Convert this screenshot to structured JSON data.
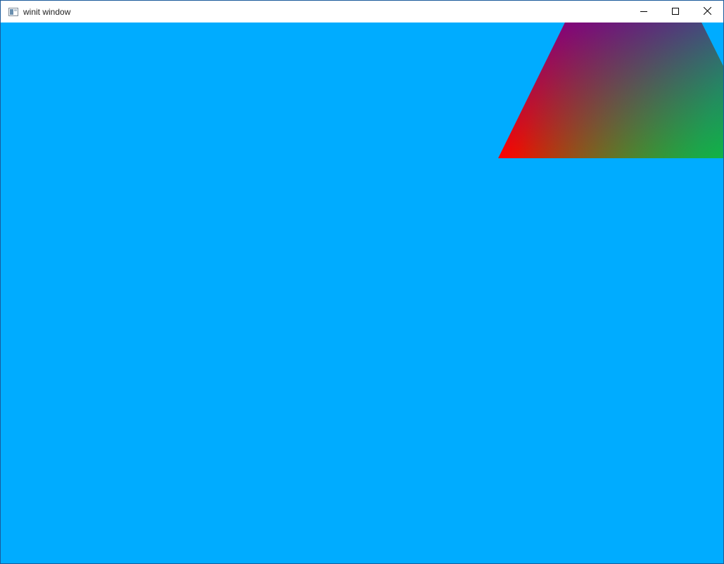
{
  "window": {
    "title": "winit window",
    "icon": "app-window-icon",
    "controls": {
      "minimize_icon": "minimize-icon",
      "maximize_icon": "maximize-icon",
      "close_icon": "close-icon"
    }
  },
  "canvas": {
    "clear_color": "#00acff",
    "triangle_vertex_colors": [
      "#ff0000",
      "#22cc00",
      "#800080"
    ]
  }
}
